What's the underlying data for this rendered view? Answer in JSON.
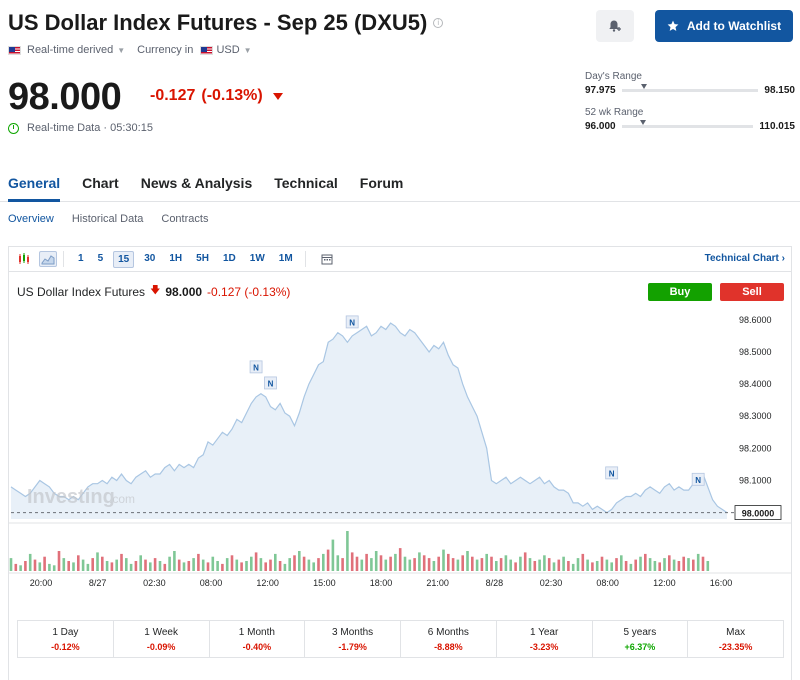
{
  "header": {
    "title": "US Dollar Index Futures - Sep 25 (DXU5)",
    "realtime_label": "Real-time derived",
    "currency_label": "Currency in",
    "currency": "USD",
    "watchlist_label": "Add to Watchlist"
  },
  "quote": {
    "price": "98.000",
    "change": "-0.127",
    "change_pct": "(-0.13%)",
    "realtime_text": "Real-time Data · 05:30:15"
  },
  "ranges": {
    "day_label": "Day's Range",
    "day_low": "97.975",
    "day_high": "98.150",
    "day_position": 0.14,
    "wk52_label": "52 wk Range",
    "wk52_low": "96.000",
    "wk52_high": "110.015",
    "wk52_position": 0.14
  },
  "tabs": [
    {
      "label": "General",
      "active": true
    },
    {
      "label": "Chart",
      "active": false
    },
    {
      "label": "News & Analysis",
      "active": false
    },
    {
      "label": "Technical",
      "active": false
    },
    {
      "label": "Forum",
      "active": false
    }
  ],
  "subtabs": [
    {
      "label": "Overview",
      "active": true
    },
    {
      "label": "Historical Data",
      "active": false
    },
    {
      "label": "Contracts",
      "active": false
    }
  ],
  "toolbar": {
    "timeframes": [
      "1",
      "5",
      "15",
      "30",
      "1H",
      "5H",
      "1D",
      "1W",
      "1M"
    ],
    "active_timeframe": "15",
    "tech_chart_label": "Technical Chart",
    "tech_chart_arrow": "›"
  },
  "chart_header": {
    "name": "US Dollar Index Futures",
    "price": "98.000",
    "change": "-0.127 (-0.13%)",
    "buy_label": "Buy",
    "sell_label": "Sell"
  },
  "chart_data": {
    "type": "area",
    "x": [
      "20:00",
      "8/27",
      "02:30",
      "08:00",
      "12:00",
      "15:00",
      "18:00",
      "21:00",
      "8/28",
      "02:30",
      "08:00",
      "12:00",
      "16:00"
    ],
    "y_ticks": [
      "98.6000",
      "98.5000",
      "98.4000",
      "98.3000",
      "98.2000",
      "98.1000"
    ],
    "ylim": [
      97.98,
      98.64
    ],
    "current_price_label": "98.0000",
    "current_price": 98.0,
    "watermark": "Investing",
    "watermark_suffix": ".com",
    "news_marker_label": "N",
    "news_markers": [
      {
        "index": 51,
        "y": 98.41
      },
      {
        "index": 54,
        "y": 98.36
      },
      {
        "index": 71,
        "y": 98.55
      },
      {
        "index": 125,
        "y": 98.08
      },
      {
        "index": 143,
        "y": 98.06
      }
    ],
    "values": [
      98.08,
      98.07,
      98.06,
      98.05,
      98.06,
      98.08,
      98.1,
      98.09,
      98.08,
      98.06,
      98.05,
      98.05,
      98.04,
      98.05,
      98.04,
      98.06,
      98.08,
      98.09,
      98.09,
      98.1,
      98.09,
      98.11,
      98.1,
      98.12,
      98.1,
      98.09,
      98.11,
      98.12,
      98.13,
      98.11,
      98.12,
      98.12,
      98.14,
      98.15,
      98.13,
      98.15,
      98.14,
      98.15,
      98.14,
      98.17,
      98.18,
      98.22,
      98.21,
      98.23,
      98.25,
      98.24,
      98.26,
      98.29,
      98.28,
      98.31,
      98.34,
      98.36,
      98.37,
      98.36,
      98.33,
      98.32,
      98.34,
      98.31,
      98.3,
      98.27,
      98.31,
      98.36,
      98.4,
      98.43,
      98.46,
      98.47,
      98.53,
      98.54,
      98.56,
      98.55,
      98.53,
      98.55,
      98.56,
      98.57,
      98.58,
      98.55,
      98.56,
      98.58,
      98.57,
      98.59,
      98.58,
      98.56,
      98.55,
      98.57,
      98.56,
      98.54,
      98.52,
      98.5,
      98.52,
      98.51,
      98.53,
      98.49,
      98.46,
      98.45,
      98.4,
      98.36,
      98.33,
      98.3,
      98.25,
      98.2,
      98.1,
      98.09,
      98.1,
      98.11,
      98.09,
      98.1,
      98.11,
      98.1,
      98.09,
      98.1,
      98.11,
      98.09,
      98.1,
      98.08,
      98.07,
      98.07,
      98.06,
      98.03,
      98.03,
      98.02,
      98.03,
      98.01,
      98.02,
      98.01,
      98.0,
      98.01,
      98.03,
      98.04,
      98.05,
      98.05,
      98.06,
      98.05,
      98.07,
      98.08,
      98.07,
      98.06,
      98.08,
      98.09,
      98.07,
      98.08,
      98.07,
      98.07,
      98.09,
      98.1,
      98.12,
      98.08,
      98.04,
      98.02,
      98.01,
      98.0
    ],
    "volumes": [
      9,
      5,
      4,
      7,
      12,
      8,
      6,
      10,
      5,
      4,
      14,
      9,
      7,
      6,
      11,
      8,
      5,
      9,
      13,
      10,
      7,
      6,
      8,
      12,
      9,
      5,
      7,
      11,
      8,
      6,
      9,
      7,
      5,
      10,
      14,
      8,
      6,
      7,
      9,
      12,
      8,
      6,
      10,
      7,
      5,
      9,
      11,
      8,
      6,
      7,
      10,
      13,
      9,
      6,
      8,
      12,
      7,
      5,
      9,
      11,
      14,
      10,
      8,
      6,
      9,
      12,
      15,
      22,
      11,
      9,
      28,
      13,
      10,
      8,
      12,
      9,
      14,
      11,
      8,
      10,
      12,
      16,
      10,
      8,
      9,
      13,
      11,
      9,
      7,
      10,
      15,
      12,
      9,
      8,
      11,
      14,
      10,
      8,
      9,
      12,
      10,
      7,
      9,
      11,
      8,
      6,
      10,
      13,
      9,
      7,
      8,
      11,
      9,
      6,
      8,
      10,
      7,
      5,
      9,
      12,
      8,
      6,
      7,
      10,
      8,
      6,
      9,
      11,
      7,
      5,
      8,
      10,
      12,
      9,
      7,
      6,
      9,
      11,
      8,
      7,
      10,
      9,
      8,
      12,
      10,
      7
    ],
    "volume_colors": [
      "up",
      "down",
      "up",
      "down",
      "up",
      "down",
      "up",
      "down",
      "up",
      "up",
      "down",
      "up",
      "down",
      "up",
      "down",
      "up",
      "up",
      "down",
      "up",
      "down",
      "up",
      "down",
      "up",
      "down",
      "up",
      "up",
      "down",
      "up",
      "down",
      "up",
      "down",
      "up",
      "down",
      "up",
      "up",
      "down",
      "up",
      "down",
      "up",
      "down",
      "up",
      "down",
      "up",
      "up",
      "down",
      "up",
      "down",
      "up",
      "down",
      "up",
      "up",
      "down",
      "up",
      "down",
      "down",
      "up",
      "down",
      "up",
      "up",
      "down",
      "up",
      "down",
      "up",
      "up",
      "down",
      "up",
      "down",
      "up",
      "up",
      "down",
      "up",
      "down",
      "down",
      "up",
      "down",
      "up",
      "up",
      "down",
      "up",
      "down",
      "up",
      "down",
      "up",
      "up",
      "down",
      "up",
      "down",
      "down",
      "up",
      "down",
      "up",
      "down",
      "down",
      "up",
      "down",
      "up",
      "down",
      "up",
      "down",
      "up",
      "down",
      "up",
      "down",
      "up",
      "up",
      "down",
      "up",
      "down",
      "up",
      "down",
      "up",
      "up",
      "down",
      "up",
      "down",
      "up",
      "down",
      "up",
      "up",
      "down",
      "up",
      "down",
      "up",
      "down",
      "up",
      "up",
      "down",
      "up",
      "down",
      "up",
      "down",
      "up",
      "down",
      "up",
      "up",
      "down",
      "up",
      "down",
      "up",
      "down",
      "down",
      "up",
      "down",
      "up",
      "down",
      "up"
    ],
    "colors": {
      "line": "#a9c6e3",
      "fill": "#e8f0f8",
      "up": "#7fc796",
      "down": "#e0707a",
      "dash": "#6b6f75"
    }
  },
  "performance": [
    {
      "label": "1 Day",
      "value": "-0.12%",
      "sign": "neg"
    },
    {
      "label": "1 Week",
      "value": "-0.09%",
      "sign": "neg"
    },
    {
      "label": "1 Month",
      "value": "-0.40%",
      "sign": "neg"
    },
    {
      "label": "3 Months",
      "value": "-1.79%",
      "sign": "neg"
    },
    {
      "label": "6 Months",
      "value": "-8.88%",
      "sign": "neg"
    },
    {
      "label": "1 Year",
      "value": "-3.23%",
      "sign": "neg"
    },
    {
      "label": "5 years",
      "value": "+6.37%",
      "sign": "pos"
    },
    {
      "label": "Max",
      "value": "-23.35%",
      "sign": "neg"
    }
  ]
}
